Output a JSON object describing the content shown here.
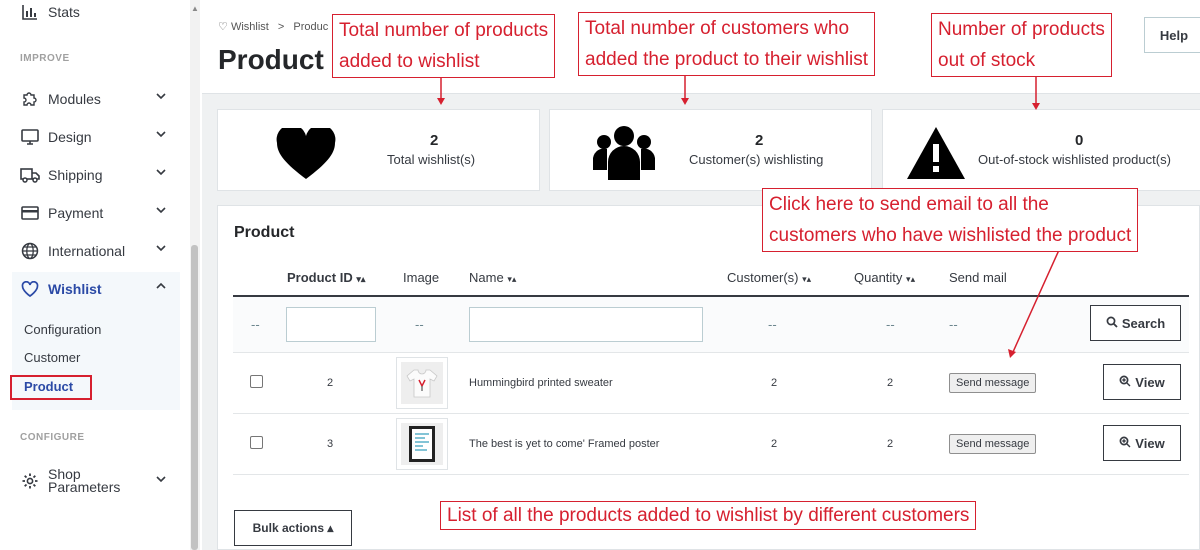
{
  "sidebar": {
    "stats_label": "Stats",
    "improve_section": "IMPROVE",
    "configure_section": "CONFIGURE",
    "items": [
      {
        "label": "Modules",
        "icon": "puzzle-icon"
      },
      {
        "label": "Design",
        "icon": "monitor-icon"
      },
      {
        "label": "Shipping",
        "icon": "truck-icon"
      },
      {
        "label": "Payment",
        "icon": "credit-card-icon"
      },
      {
        "label": "International",
        "icon": "globe-icon"
      },
      {
        "label": "Wishlist",
        "icon": "heart-icon"
      }
    ],
    "wishlist_sub": [
      "Configuration",
      "Customer",
      "Product"
    ],
    "shop_params_line1": "Shop",
    "shop_params_line2": "Parameters"
  },
  "header": {
    "breadcrumb_1": "Wishlist",
    "breadcrumb_sep": ">",
    "breadcrumb_2": "Produc",
    "title": "Product",
    "help_label": "Help"
  },
  "kpis": [
    {
      "value": "2",
      "label": "Total wishlist(s)",
      "icon": "heart-icon"
    },
    {
      "value": "2",
      "label": "Customer(s) wishlisting",
      "icon": "users-icon"
    },
    {
      "value": "0",
      "label": "Out-of-stock wishlisted product(s)",
      "icon": "warning-icon"
    }
  ],
  "panel": {
    "title": "Product",
    "columns": {
      "product_id": "Product ID",
      "image": "Image",
      "name": "Name",
      "customers": "Customer(s)",
      "quantity": "Quantity",
      "send_mail": "Send mail"
    },
    "sort_glyph": "▾▴",
    "filter_dash": "--",
    "search_label": "Search",
    "rows": [
      {
        "id": "2",
        "name": "Hummingbird printed sweater",
        "customers": "2",
        "quantity": "2",
        "send_label": "Send message",
        "view_label": "View"
      },
      {
        "id": "3",
        "name": "The best is yet to come' Framed poster",
        "customers": "2",
        "quantity": "2",
        "send_label": "Send message",
        "view_label": "View"
      }
    ],
    "bulk_label": "Bulk actions ▴"
  },
  "annotations": {
    "a1_line1": "Total number of products",
    "a1_line2": "added to wishlist",
    "a2_line1": "Total number of customers who",
    "a2_line2": "added the product to their wishlist",
    "a3_line1": "Number of products",
    "a3_line2": "out of stock",
    "a4_line1": "Click here to send email to all the",
    "a4_line2": "customers who have wishlisted the product",
    "a5": "List of all the products added to wishlist by different customers"
  },
  "colors": {
    "annotation_red": "#d6202f",
    "active_nav": "#2b4aa6",
    "content_bg": "#eff1f2"
  }
}
